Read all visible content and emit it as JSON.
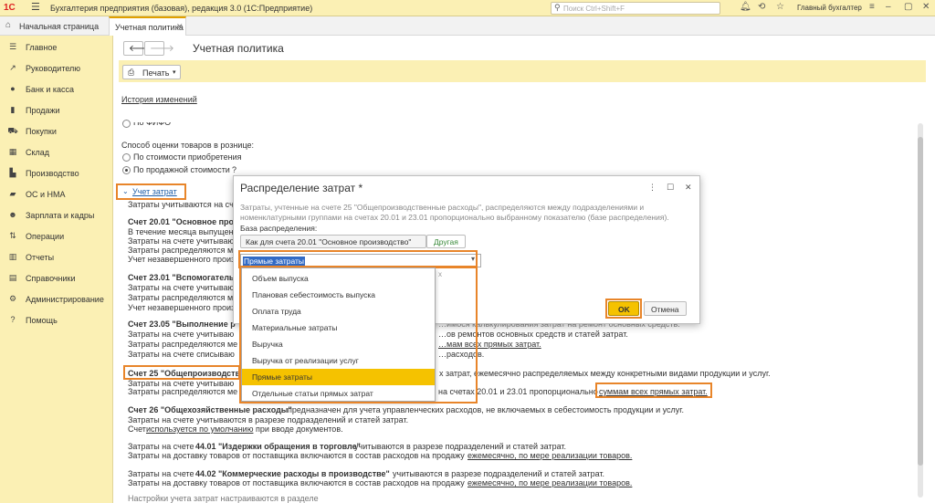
{
  "window": {
    "logo": "1С",
    "title": "Бухгалтерия предприятия (базовая), редакция 3.0 (1С:Предприятие)",
    "search_placeholder": "Поиск Ctrl+Shift+F",
    "user": "Главный бухгалтер"
  },
  "tabs": {
    "home": "Начальная страница",
    "current": "Учетная политика"
  },
  "sidebar": {
    "items": [
      {
        "label": "Главное",
        "icon": "menu-icon"
      },
      {
        "label": "Руководителю",
        "icon": "chart-line-icon"
      },
      {
        "label": "Банк и касса",
        "icon": "bank-icon"
      },
      {
        "label": "Продажи",
        "icon": "sales-icon"
      },
      {
        "label": "Покупки",
        "icon": "cart-icon"
      },
      {
        "label": "Склад",
        "icon": "warehouse-icon"
      },
      {
        "label": "Производство",
        "icon": "factory-icon"
      },
      {
        "label": "ОС и НМА",
        "icon": "truck-icon"
      },
      {
        "label": "Зарплата и кадры",
        "icon": "people-icon"
      },
      {
        "label": "Операции",
        "icon": "operations-icon"
      },
      {
        "label": "Отчеты",
        "icon": "report-icon"
      },
      {
        "label": "Справочники",
        "icon": "book-icon"
      },
      {
        "label": "Администрирование",
        "icon": "gear-icon"
      },
      {
        "label": "Помощь",
        "icon": "help-icon"
      }
    ]
  },
  "page": {
    "title": "Учетная политика",
    "print_label": "Печать",
    "history_link": "История изменений",
    "fifo_label": "По ФИФО",
    "retail_label": "Способ оценки товаров в рознице:",
    "retail_opt1": "По стоимости приобретения",
    "retail_opt2": "По продажной стоимости",
    "q": "?",
    "section": "Учет затрат",
    "intro": "Затраты учитываются на сч",
    "s20_title": "Счет 20.01 \"Основное произ",
    "s20_l1": "В течение месяца выпущен",
    "s20_l2": "Затраты на счете учитываю",
    "s20_l3": "Затраты распределяются м",
    "s20_l4": "Учет незавершенного произ",
    "s23_title": "Счет 23.01 \"Вспомогатель",
    "s23_l1": "Затраты на счете учитываю",
    "s23_l2": "Затраты распределяются м",
    "s23_l3": "Учет незавершенного произ",
    "s235_title": "Счет 23.05 \"Выполнение р",
    "s235_t1_tail": "…имося калькулирования затрат на ремонт основных средств.",
    "s235_l1": "Затраты на счете учитываю",
    "s235_l1_tail": "…ов ремонтов основных средств и статей затрат.",
    "s235_l2": "Затраты распределяются ме",
    "s235_l2_link": "…мам всех прямых затрат.",
    "s235_l3": "Затраты на счете списываю",
    "s235_l3_tail": "…расходов.",
    "s25_title": "Счет 25 \"Общепроизводств",
    "s25_t_tail": "х затрат, ежемесячно распределяемых между конкретными видами продукции и услуг.",
    "s25_l1": "Затраты на счете учитываю",
    "s25_l2": "Затраты распределяются ме",
    "s25_l2_tail": "на счетах 20.01 и 23.01 пропорционально",
    "s25_link": "суммам всех прямых затрат.",
    "s26_title": "Счет 26 \"Общехозяйственные расходы\"",
    "s26_t_tail": " предназначен для учета управленческих расходов, не включаемых в себестоимость продукции и услуг.",
    "s26_l1": "Затраты на счете учитываются в разрезе подразделений и статей затрат.",
    "s26_l2_pre": "Счет ",
    "s26_link": "используется по умолчанию",
    "s26_l2_post": " при вводе документов.",
    "s4401_pre": "Затраты на счете ",
    "s4401_b": "44.01 \"Издержки обращения в торговле\"",
    "s4401_tail": " учитываются в разрезе подразделений и статей затрат.",
    "s4401_l2": "Затраты на доставку товаров от поставщика включаются в состав расходов на продажу ",
    "s4401_link": "ежемесячно, по мере реализации товаров.",
    "s4402_pre": "Затраты на счете ",
    "s4402_b": "44.02 \"Коммерческие расходы в производстве\"",
    "s4402_tail": " учитываются в разрезе подразделений и статей затрат.",
    "s4402_l2": "Затраты на доставку товаров от поставщика включаются в состав расходов на продажу ",
    "s4402_link": "ежемесячно, по мере реализации товаров.",
    "cut_line": "Настройки учета затрат настраиваются в разделе"
  },
  "dialog": {
    "title": "Распределение затрат *",
    "description": "Затраты, учтенные на счете 25 \"Общепроизводственные расходы\", распределяются между подразделениями и номенклатурными группами на счетах 20.01 и 23.01 пропорционально выбранному показателю (базе распределения).",
    "basis_label": "База распределения:",
    "basis_option1": "Как для счета 20.01 \"Основное производство\"",
    "basis_option2": "Другая",
    "combo_value": "Прямые затраты",
    "ok": "OK",
    "cancel": "Отмена",
    "close_mark": "x"
  },
  "dropdown": {
    "items": [
      "Объем выпуска",
      "Плановая себестоимость выпуска",
      "Оплата труда",
      "Материальные затраты",
      "Выручка",
      "Выручка от реализации услуг",
      "Прямые затраты",
      "Отдельные статьи прямых затрат"
    ],
    "selected_index": 6
  },
  "colors": {
    "accent_yellow": "#fbf0b4",
    "highlight_orange": "#e8852a",
    "selected": "#f5c200",
    "link": "#1f5fa8"
  }
}
